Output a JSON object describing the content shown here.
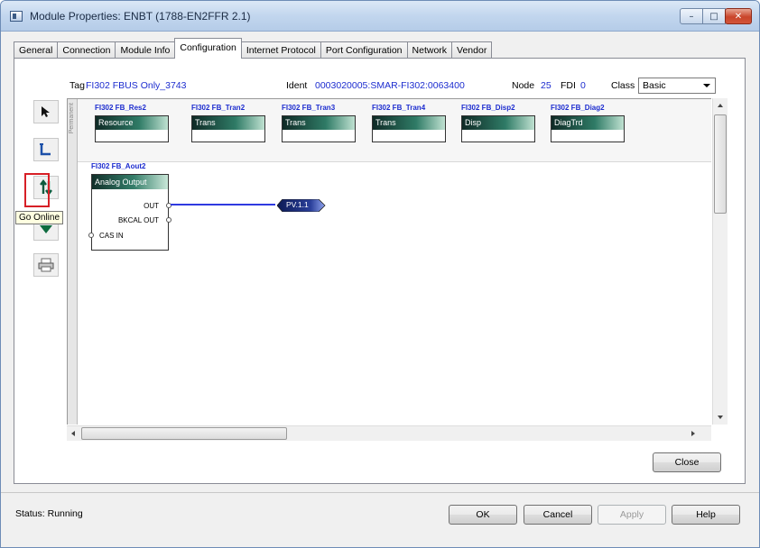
{
  "window": {
    "title": "Module Properties: ENBT (1788-EN2FFR 2.1)",
    "min_glyph": "–",
    "max_glyph": "□",
    "close_glyph": "✕"
  },
  "tabs": [
    {
      "label": "General"
    },
    {
      "label": "Connection"
    },
    {
      "label": "Module Info"
    },
    {
      "label": "Configuration",
      "active": true
    },
    {
      "label": "Internet Protocol"
    },
    {
      "label": "Port Configuration"
    },
    {
      "label": "Network"
    },
    {
      "label": "Vendor"
    }
  ],
  "header": {
    "tag_label": "Tag",
    "tag_value": "FI302 FBUS Only_3743",
    "ident_label": "Ident",
    "ident_value": "0003020005:SMAR-FI302:0063400",
    "node_label": "Node",
    "node_value": "25",
    "fdi_label": "FDI",
    "fdi_value": "0",
    "class_label": "Class",
    "class_value": "Basic"
  },
  "tools": {
    "tooltip": "Go Online"
  },
  "canvas": {
    "permanent_label": "Permanent",
    "permanent_blocks": [
      {
        "name": "FI302 FB_Res2",
        "type": "Resource"
      },
      {
        "name": "FI302 FB_Tran2",
        "type": "Trans"
      },
      {
        "name": "FI302 FB_Tran3",
        "type": "Trans"
      },
      {
        "name": "FI302 FB_Tran4",
        "type": "Trans"
      },
      {
        "name": "FI302 FB_Disp2",
        "type": "Disp"
      },
      {
        "name": "FI302 FB_Diag2",
        "type": "DiagTrd"
      }
    ],
    "ao_block": {
      "name": "FI302 FB_Aout2",
      "type": "Analog Output",
      "ports": {
        "out": "OUT",
        "bkcal_out": "BKCAL OUT",
        "cas_in": "CAS IN"
      }
    },
    "pv_tag": "PV.1.1"
  },
  "footer": {
    "close_label": "Close",
    "status_label": "Status:",
    "status_value": "Running",
    "ok_label": "OK",
    "cancel_label": "Cancel",
    "apply_label": "Apply",
    "help_label": "Help"
  }
}
